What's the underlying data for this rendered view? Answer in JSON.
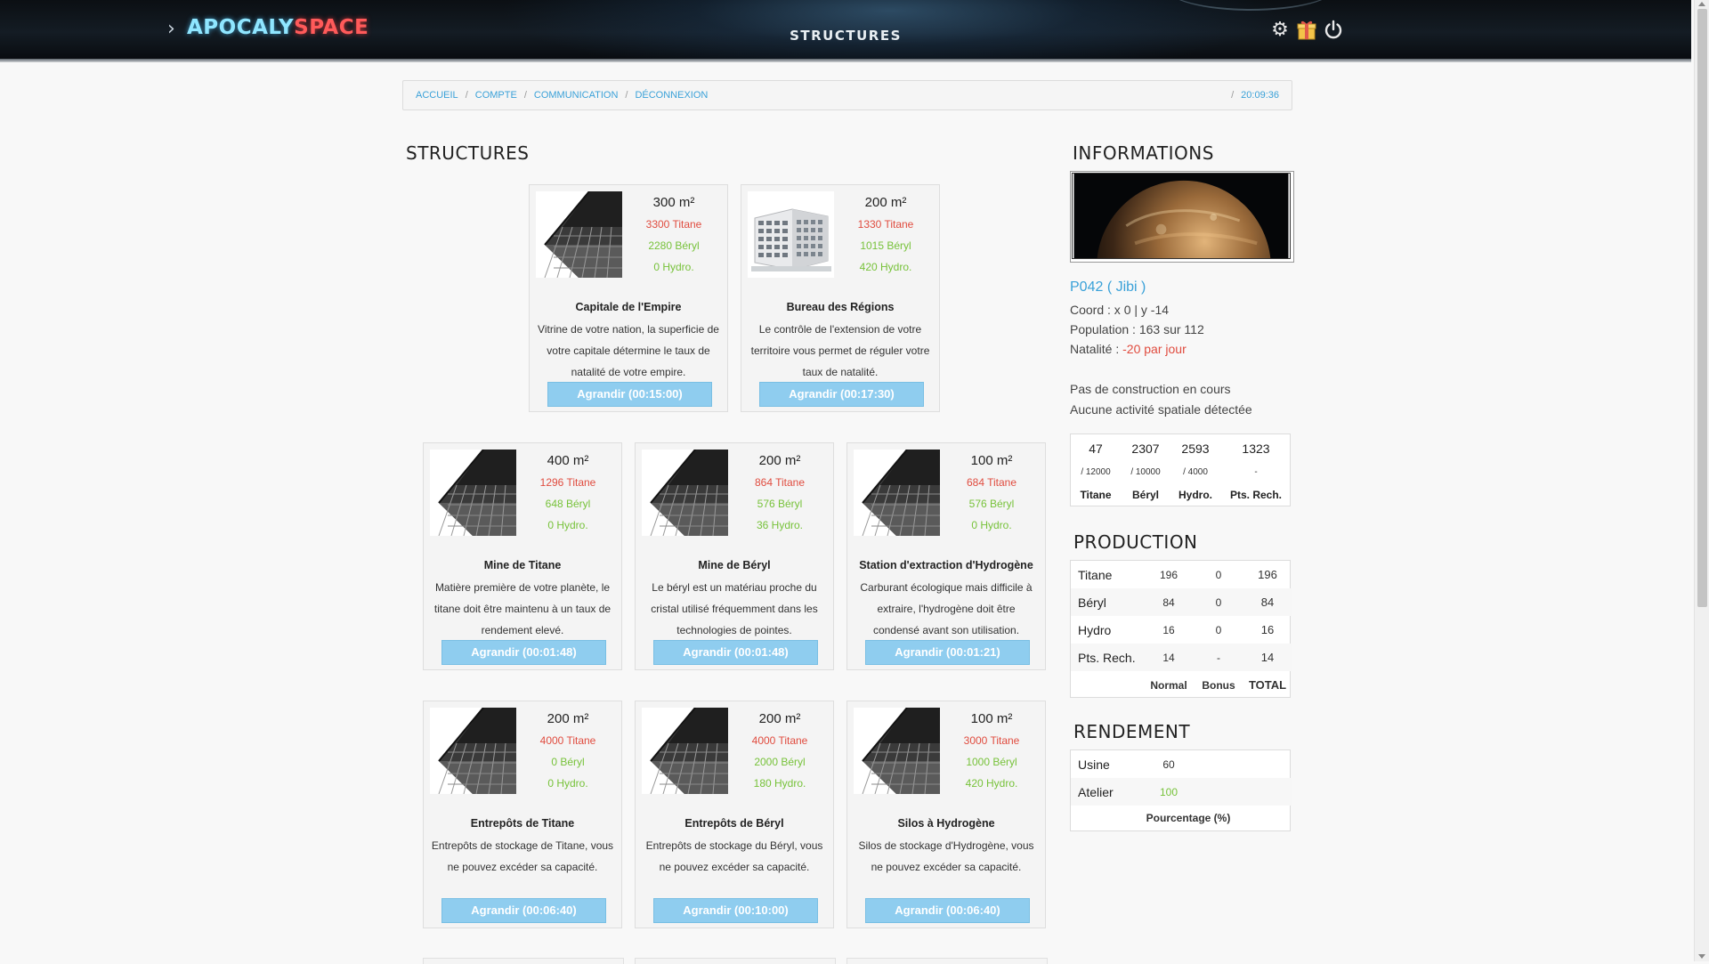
{
  "app": {
    "brand_part1": "APOCALY",
    "brand_part2": "SPACE",
    "page_title": "STRUCTURES",
    "icons": [
      "settings-gear-icon",
      "gift-icon",
      "power-icon"
    ]
  },
  "breadcrumb": {
    "links": [
      "ACCUEIL",
      "COMPTE",
      "COMMUNICATION",
      "DÉCONNEXION"
    ],
    "time": "20:09:36"
  },
  "structures": {
    "heading": "STRUCTURES",
    "cards": [
      {
        "area": "300 m²",
        "titane": "3300 Titane",
        "beryl": "2280 Béryl",
        "hydro": "0 Hydro.",
        "name": "Capitale de l'Empire",
        "desc": "Vitrine de votre nation, la superficie de votre capitale détermine le taux de natalité de votre empire.",
        "button": "Agrandir (00:15:00)",
        "image": "building-photo"
      },
      {
        "area": "200 m²",
        "titane": "1330 Titane",
        "beryl": "1015 Béryl",
        "hydro": "420 Hydro.",
        "name": "Bureau des Régions",
        "desc": "Le contrôle de l'extension de votre territoire vous permet de réguler votre taux de natalité.",
        "button": "Agrandir (00:17:30)",
        "image": "office-photo"
      },
      {
        "area": "400 m²",
        "titane": "1296 Titane",
        "beryl": "648 Béryl",
        "hydro": "0 Hydro.",
        "name": "Mine de Titane",
        "desc": "Matière première de votre planète, le titane doit être maintenu à un taux de rendement elevé.",
        "button": "Agrandir (00:01:48)",
        "image": "building-photo"
      },
      {
        "area": "200 m²",
        "titane": "864 Titane",
        "beryl": "576 Béryl",
        "hydro": "36 Hydro.",
        "name": "Mine de Béryl",
        "desc": "Le béryl est un matériau proche du cristal utilisé fréquemment dans les technologies de pointes.",
        "button": "Agrandir (00:01:48)",
        "image": "building-photo"
      },
      {
        "area": "100 m²",
        "titane": "684 Titane",
        "beryl": "576 Béryl",
        "hydro": "0 Hydro.",
        "name": "Station d'extraction d'Hydrogène",
        "desc": "Carburant écologique mais difficile à extraire, l'hydrogène doit être condensé avant son utilisation.",
        "button": "Agrandir (00:01:21)",
        "image": "building-photo"
      },
      {
        "area": "200 m²",
        "titane": "4000 Titane",
        "beryl": "0 Béryl",
        "hydro": "0 Hydro.",
        "name": "Entrepôts de Titane",
        "desc": "Entrepôts de stockage de Titane, vous ne pouvez excéder sa capacité.",
        "button": "Agrandir (00:06:40)",
        "image": "building-photo"
      },
      {
        "area": "200 m²",
        "titane": "4000 Titane",
        "beryl": "2000 Béryl",
        "hydro": "180 Hydro.",
        "name": "Entrepôts de Béryl",
        "desc": "Entrepôts de stockage du Béryl, vous ne pouvez excéder sa capacité.",
        "button": "Agrandir (00:10:00)",
        "image": "building-photo"
      },
      {
        "area": "100 m²",
        "titane": "3000 Titane",
        "beryl": "1000 Béryl",
        "hydro": "420 Hydro.",
        "name": "Silos à Hydrogène",
        "desc": "Silos de stockage d'Hydrogène, vous ne pouvez excéder sa capacité.",
        "button": "Agrandir (00:06:40)",
        "image": "building-photo"
      }
    ]
  },
  "informations": {
    "heading": "INFORMATIONS",
    "planet_name": "P042 ( Jibi )",
    "coord": "Coord : x 0 | y -14",
    "population": "Population : 163 sur 112",
    "natalite_label": "Natalité :",
    "natalite_value": "-20 par jour",
    "construction": "Pas de construction en cours",
    "activity": "Aucune activité spatiale détectée",
    "resources": {
      "values": [
        "47",
        "2307",
        "2593",
        "1323"
      ],
      "capacities": [
        "/ 12000",
        "/ 10000",
        "/ 4000",
        "-"
      ],
      "labels": [
        "Titane",
        "Béryl",
        "Hydro.",
        "Pts. Rech."
      ]
    }
  },
  "production": {
    "heading": "PRODUCTION",
    "rows": [
      {
        "label": "Titane",
        "normal": "196",
        "bonus": "0",
        "total": "196"
      },
      {
        "label": "Béryl",
        "normal": "84",
        "bonus": "0",
        "total": "84"
      },
      {
        "label": "Hydro",
        "normal": "16",
        "bonus": "0",
        "total": "16"
      },
      {
        "label": "Pts. Rech.",
        "normal": "14",
        "bonus": "-",
        "total": "14"
      }
    ],
    "headers": [
      "Normal",
      "Bonus",
      "TOTAL"
    ]
  },
  "rendement": {
    "heading": "RENDEMENT",
    "rows": [
      {
        "label": "Usine",
        "value": "60"
      },
      {
        "label": "Atelier",
        "value": "100"
      }
    ],
    "footer": "Pourcentage (%)"
  }
}
